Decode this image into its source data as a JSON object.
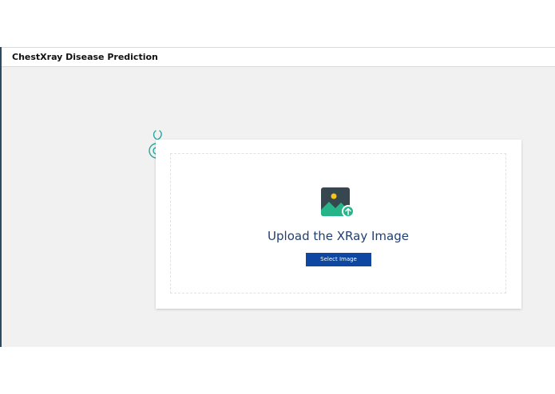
{
  "header": {
    "title": "ChestXray Disease Prediction"
  },
  "upload": {
    "title": "Upload the XRay Image",
    "button_label": "Select Image"
  },
  "icons": {
    "logo": "stethoscope-icon",
    "upload": "image-upload-icon"
  },
  "colors": {
    "title_text": "#1f3f73",
    "button_bg": "#0d47a1",
    "logo": "#26a69a",
    "icon_frame": "#37474f",
    "icon_mountain": "#26b589",
    "icon_sun": "#f5c518"
  }
}
